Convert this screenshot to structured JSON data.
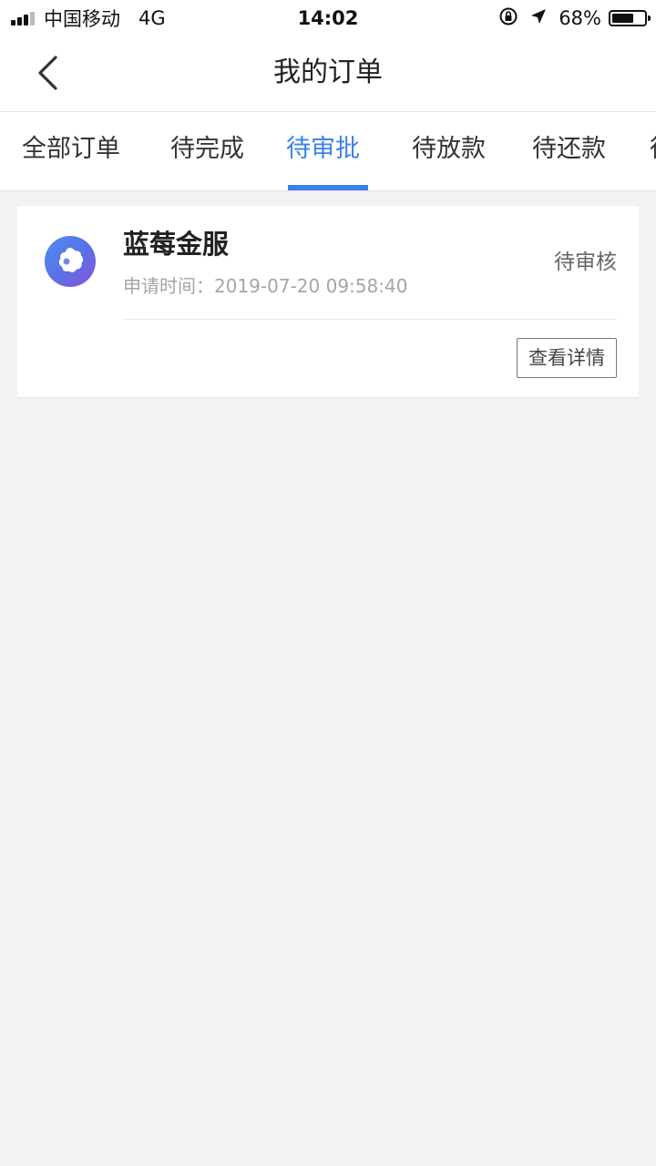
{
  "status_bar": {
    "carrier": "中国移动",
    "network": "4G",
    "time": "14:02",
    "battery_text": "68%",
    "battery_level": 0.68
  },
  "nav": {
    "title": "我的订单"
  },
  "tabs": [
    {
      "label": "全部订单",
      "active": false
    },
    {
      "label": "待完成",
      "active": false
    },
    {
      "label": "待审批",
      "active": true
    },
    {
      "label": "待放款",
      "active": false
    },
    {
      "label": "待还款",
      "active": false
    },
    {
      "label": "待",
      "active": false
    }
  ],
  "orders": [
    {
      "name": "蓝莓金服",
      "time_label": "申请时间：",
      "time_value": "2019-07-20 09:58:40",
      "status": "待审核",
      "detail_button": "查看详情"
    }
  ],
  "colors": {
    "accent": "#3b82e8",
    "background": "#f1f2f4"
  },
  "icons": {
    "back": "chevron-left-icon",
    "logo": "blueberry-logo-icon"
  }
}
